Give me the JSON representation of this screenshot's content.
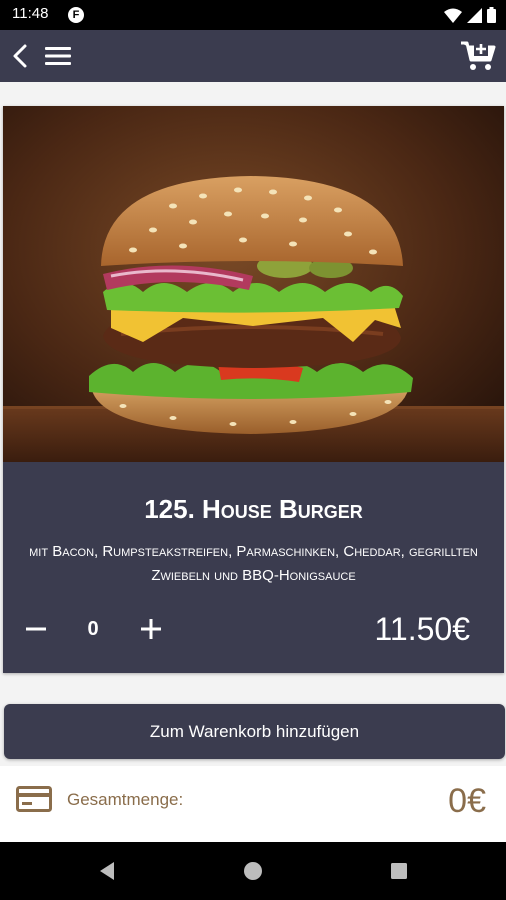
{
  "status_bar": {
    "time": "11:48",
    "notification_glyph": "F"
  },
  "product": {
    "title": "125. House Burger",
    "description": "mit Bacon, Rumpsteakstreifen, Parmaschinken, Cheddar, gegrillten Zwiebeln und BBQ-Honigsauce",
    "quantity": "0",
    "price": "11.50€",
    "image_icon": "burger-photo"
  },
  "actions": {
    "add_to_cart_label": "Zum Warenkorb hinzufügen"
  },
  "footer": {
    "total_label": "Gesamtmenge:",
    "total_value": "0€"
  },
  "icons": {
    "back": "back-icon",
    "menu": "menu-icon",
    "cart": "cart-add-icon",
    "minus": "minus-icon",
    "plus": "plus-icon",
    "card": "credit-card-icon"
  },
  "colors": {
    "primary": "#3b3c4f",
    "accent": "#8a6d4b",
    "background": "#f3f3f3"
  }
}
